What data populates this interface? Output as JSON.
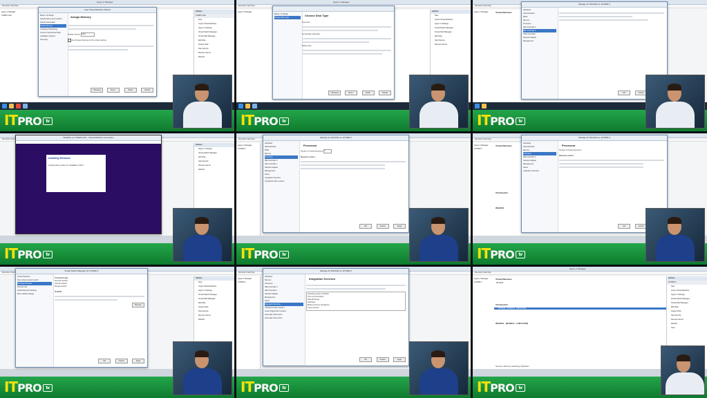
{
  "brand": {
    "it": "IT",
    "pro": "PRO",
    "tv": "tv"
  },
  "manager": {
    "title": "Hyper-V Manager",
    "menu": "File  Action  View  Help",
    "tree_root": "Hyper-V Manager",
    "host": "CSSRX-CLE",
    "host2": "HYPER-V",
    "actions_header": "Actions",
    "actions_sub": "CSSRX-CLE",
    "actions": [
      "New",
      "Import Virtual Machine...",
      "Hyper-V Settings...",
      "Virtual Switch Manager...",
      "Virtual SAN Manager...",
      "Edit Disk...",
      "Inspect Disk...",
      "Stop Service",
      "Remove Server",
      "Refresh",
      "View",
      "Help"
    ],
    "vm_section": "Virtual Machines",
    "vm_name": "Win2012",
    "vm_date": "Win2012 - (6/4/2014 - 3:58:34 PM)",
    "checkpoints": "Checkpoints",
    "tabs": [
      "Summary",
      "Memory",
      "Networking",
      "Replication"
    ]
  },
  "wizard": {
    "title": "New Virtual Machine Wizard",
    "assign_memory": "Assign Memory",
    "choose_disk": "Choose Disk Type",
    "nav": [
      "Before You Begin",
      "Specify Name and Location",
      "Specify Generation",
      "Assign Memory",
      "Configure Networking",
      "Connect Virtual Hard Disk",
      "Installation Options",
      "Summary"
    ],
    "startup_label": "Startup memory:",
    "startup_value": "1024",
    "dynamic_label": "Use Dynamic Memory for this virtual machine.",
    "fixed": "Fixed size",
    "dynamic": "Dynamically expanding",
    "differencing": "Differencing"
  },
  "buttons": {
    "previous": "< Previous",
    "next": "Next >",
    "finish": "Finish",
    "cancel": "Cancel",
    "ok": "OK",
    "apply": "Apply"
  },
  "settings": {
    "title": "Settings for Win2012 on HYPER-V",
    "processor": "Processor",
    "num_proc_label": "Number of virtual processors:",
    "num_proc_value": "1",
    "resource_control": "Resource control",
    "items": [
      "Hardware",
      "Add Hardware",
      "BIOS",
      "Memory",
      "Processor",
      "IDE Controller 0",
      "IDE Controller 1",
      "SCSI Controller",
      "Network Adapter",
      "COM 1",
      "COM 2",
      "Diskette Drive",
      "Management",
      "Name",
      "Integration Services",
      "Checkpoint File Location",
      "Smart Paging File Location",
      "Automatic Start Action",
      "Automatic Stop Action"
    ],
    "integration": "Integration Services",
    "services": [
      "Operating system shutdown",
      "Time synchronization",
      "Data Exchange",
      "Heartbeat",
      "Backup (volume checkpoint)",
      "Guest services"
    ]
  },
  "switch_mgr": {
    "title": "Virtual Switch Manager for HYPER-V",
    "nav": [
      "Virtual Switches",
      "New virtual network switch",
      "Personal Intranets",
      "Internal only",
      "Global Network Settings",
      "MAC Address Range"
    ],
    "connection_type": "Connection type",
    "external": "External network:",
    "internal": "Internal network",
    "private": "Private network",
    "vlan": "VLAN ID",
    "remove": "Remove"
  },
  "vmconnect": {
    "title": "Win2012 on CSSRX-CLE - Virtual Machine Connection",
    "installing": "Installing Windows",
    "status": "Getting files ready for installation (5%)"
  }
}
